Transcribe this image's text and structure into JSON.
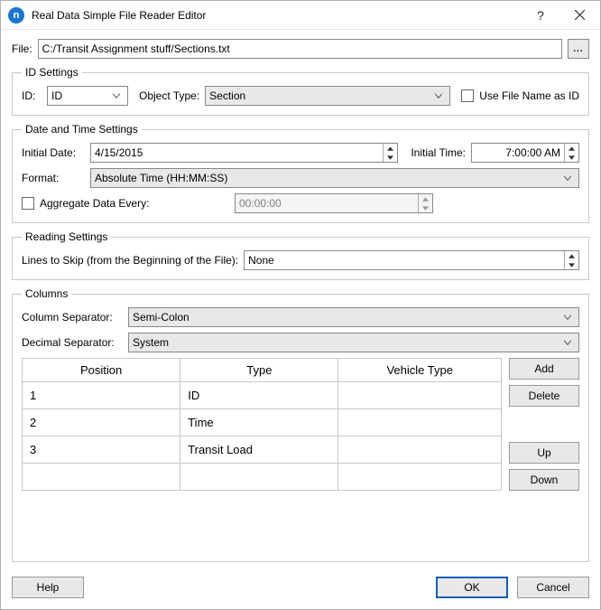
{
  "window": {
    "title": "Real Data Simple File Reader Editor"
  },
  "file": {
    "label": "File:",
    "path": "C:/Transit Assignment stuff/Sections.txt",
    "browse": "..."
  },
  "id_settings": {
    "legend": "ID Settings",
    "id_label": "ID:",
    "id_value": "ID",
    "object_type_label": "Object Type:",
    "object_type_value": "Section",
    "use_filename_label": "Use File Name as ID"
  },
  "datetime": {
    "legend": "Date and Time Settings",
    "initial_date_label": "Initial Date:",
    "initial_date_value": "4/15/2015",
    "initial_time_label": "Initial Time:",
    "initial_time_value": "7:00:00 AM",
    "format_label": "Format:",
    "format_value": "Absolute Time (HH:MM:SS)",
    "aggregate_label": "Aggregate Data Every:",
    "aggregate_value": "00:00:00"
  },
  "reading": {
    "legend": "Reading Settings",
    "lines_label": "Lines to Skip (from the Beginning of the File):",
    "lines_value": "None"
  },
  "columns": {
    "legend": "Columns",
    "col_sep_label": "Column Separator:",
    "col_sep_value": "Semi-Colon",
    "dec_sep_label": "Decimal Separator:",
    "dec_sep_value": "System",
    "headers": {
      "position": "Position",
      "type": "Type",
      "vehicle": "Vehicle Type"
    },
    "rows": [
      {
        "position": "1",
        "type": "ID",
        "vehicle": ""
      },
      {
        "position": "2",
        "type": "Time",
        "vehicle": ""
      },
      {
        "position": "3",
        "type": "Transit Load",
        "vehicle": ""
      }
    ],
    "add": "Add",
    "delete": "Delete",
    "up": "Up",
    "down": "Down"
  },
  "footer": {
    "help": "Help",
    "ok": "OK",
    "cancel": "Cancel"
  }
}
